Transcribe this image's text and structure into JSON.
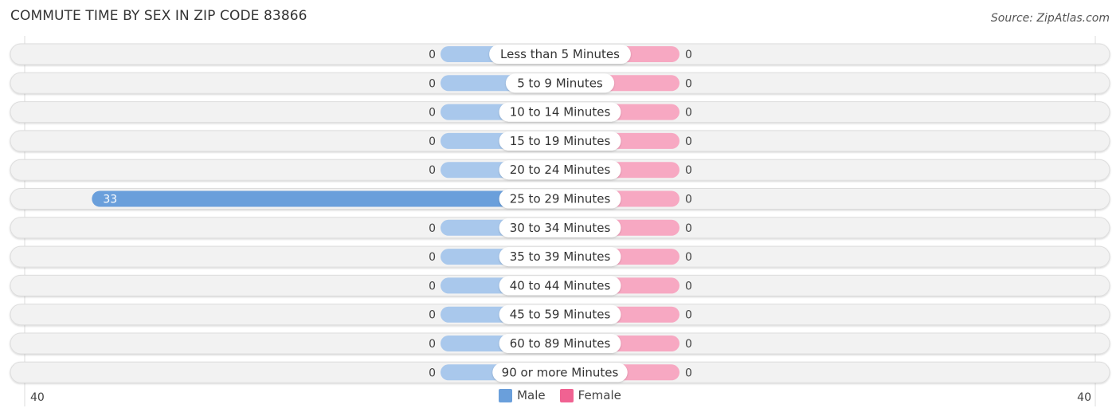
{
  "header": {
    "title": "COMMUTE TIME BY SEX IN ZIP CODE 83866",
    "source": "Source: ZipAtlas.com"
  },
  "colors": {
    "male": "#6a9fdb",
    "male_light": "#a9c8ec",
    "female": "#f06292",
    "female_light": "#f7a8c2",
    "row_bg": "#f2f2f2",
    "row_border": "#dddddd"
  },
  "legend": {
    "male_label": "Male",
    "female_label": "Female"
  },
  "chart_data": {
    "type": "bar",
    "orientation": "horizontal-diverging",
    "title": "COMMUTE TIME BY SEX IN ZIP CODE 83866",
    "categories": [
      "Less than 5 Minutes",
      "5 to 9 Minutes",
      "10 to 14 Minutes",
      "15 to 19 Minutes",
      "20 to 24 Minutes",
      "25 to 29 Minutes",
      "30 to 34 Minutes",
      "35 to 39 Minutes",
      "40 to 44 Minutes",
      "45 to 59 Minutes",
      "60 to 89 Minutes",
      "90 or more Minutes"
    ],
    "series": [
      {
        "name": "Male",
        "values": [
          0,
          0,
          0,
          0,
          0,
          33,
          0,
          0,
          0,
          0,
          0,
          0
        ]
      },
      {
        "name": "Female",
        "values": [
          0,
          0,
          0,
          0,
          0,
          0,
          0,
          0,
          0,
          0,
          0,
          0
        ]
      }
    ],
    "axis_min_label": "40",
    "axis_max_label": "40",
    "xlim": [
      -40,
      40
    ],
    "legend_position": "bottom-center",
    "grid": false
  }
}
